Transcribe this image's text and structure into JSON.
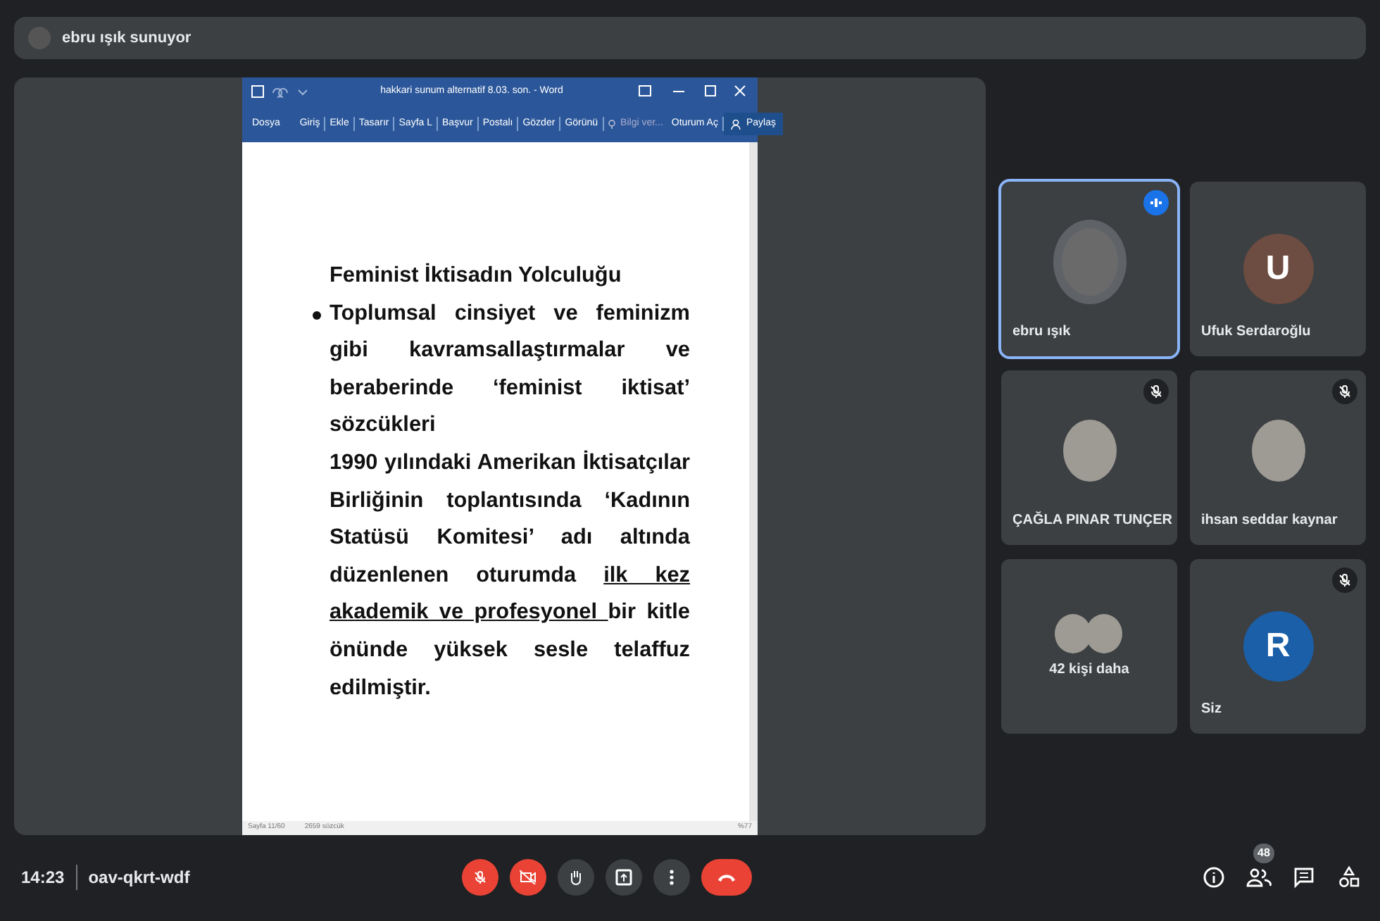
{
  "presenter_bar": {
    "text": "ebru ışık sunuyor"
  },
  "word_window": {
    "title": "hakkari sunum alternatif 8.03. son. - Word",
    "ribbon_tabs": [
      {
        "label": "Dosya",
        "kind": "tab"
      },
      {
        "label": "Giriş",
        "kind": "tab"
      },
      {
        "label": "Ekle",
        "kind": "tab"
      },
      {
        "label": "Tasarır",
        "kind": "tab"
      },
      {
        "label": "Sayfa L",
        "kind": "tab"
      },
      {
        "label": "Başvur",
        "kind": "tab"
      },
      {
        "label": "Postalı",
        "kind": "tab"
      },
      {
        "label": "Gözder",
        "kind": "tab"
      },
      {
        "label": "Görünü",
        "kind": "tab"
      },
      {
        "label": "Bilgi ver...",
        "kind": "tell"
      },
      {
        "label": "Oturum Aç",
        "kind": "tab"
      },
      {
        "label": "Paylaş",
        "kind": "share"
      }
    ],
    "document": {
      "title": "Feminist İktisadın Yolculuğu",
      "paragraphs": [
        {
          "kind": "bullet",
          "segments": [
            {
              "text": "Toplumsal cinsiyet ve feminizm gibi kavramsallaştırmalar ve beraberinde ‘feminist iktisat’ sözcükleri",
              "underlined": false
            }
          ]
        },
        {
          "kind": "plain",
          "segments": [
            {
              "text": "1990 yılındaki Amerikan İktisatçılar Birliğinin toplantısında ‘Kadının Statüsü Komitesi’ adı altında düzenlenen oturumda ",
              "underlined": false
            },
            {
              "text": "ilk kez akademik ve profesyonel ",
              "underlined": true
            },
            {
              "text": "bir kitle önünde yüksek sesle telaffuz edilmiştir.",
              "underlined": false
            }
          ]
        }
      ]
    },
    "status_bar": {
      "page": "Sayfa 11/60",
      "words": "2659 sözcük",
      "zoom": "%77"
    }
  },
  "participants": [
    {
      "name": "ebru ışık",
      "kind": "photo",
      "speaking": true,
      "muted": false,
      "selected": true
    },
    {
      "name": "Ufuk Serdaroğlu",
      "kind": "letter",
      "letter": "U",
      "color": "#6d4c41",
      "speaking": false,
      "muted": false,
      "selected": false
    },
    {
      "name": "ÇAĞLA PINAR TUNÇER",
      "kind": "photo",
      "speaking": false,
      "muted": true,
      "selected": false
    },
    {
      "name": "ihsan seddar kaynar",
      "kind": "photo",
      "speaking": false,
      "muted": true,
      "selected": false
    },
    {
      "name": "42 kişi daha",
      "kind": "group",
      "speaking": false,
      "muted": false,
      "selected": false
    },
    {
      "name": "Siz",
      "kind": "letter",
      "letter": "R",
      "color": "#1a5fa8",
      "speaking": false,
      "muted": true,
      "selected": false
    }
  ],
  "meeting": {
    "time": "14:23",
    "code": "oav-qkrt-wdf"
  },
  "controls": [
    {
      "kind": "mic",
      "off": true
    },
    {
      "kind": "camera",
      "off": true
    },
    {
      "kind": "hand",
      "off": false
    },
    {
      "kind": "present",
      "off": false
    },
    {
      "kind": "more",
      "off": false
    },
    {
      "kind": "hangup",
      "off": true
    }
  ],
  "side_buttons": [
    {
      "kind": "info"
    },
    {
      "kind": "people",
      "badge": "48"
    },
    {
      "kind": "chat"
    },
    {
      "kind": "activities"
    }
  ]
}
